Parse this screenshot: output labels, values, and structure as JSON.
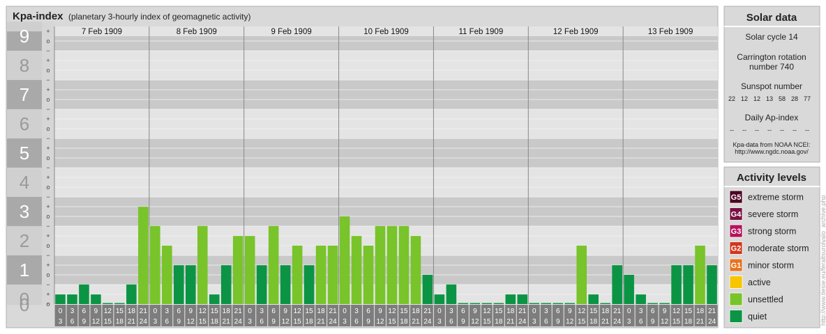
{
  "header": {
    "title": "Kpa-index",
    "subtitle": "(planetary 3-hourly index of geomagnetic activity)"
  },
  "chart_data": {
    "type": "bar",
    "days": [
      "7 Feb 1909",
      "8 Feb 1909",
      "9 Feb 1909",
      "10 Feb 1909",
      "11 Feb 1909",
      "12 Feb 1909",
      "13 Feb 1909"
    ],
    "hour_start_labels": [
      "0",
      "3",
      "6",
      "9",
      "12",
      "15",
      "18",
      "21"
    ],
    "hour_end_labels": [
      "3",
      "6",
      "9",
      "12",
      "15",
      "18",
      "21",
      "24"
    ],
    "y_tick_labels": [
      "0",
      "1",
      "2",
      "3",
      "4",
      "5",
      "6",
      "7",
      "8",
      "9"
    ],
    "y_sub_labels": [
      "o",
      "+",
      "−"
    ],
    "ylim": [
      0,
      9.33
    ],
    "values": [
      0.33,
      0.33,
      0.67,
      0.33,
      0,
      0,
      0.67,
      3.33,
      2.67,
      2,
      1.33,
      1.33,
      2.67,
      0.33,
      1.33,
      2.33,
      2.33,
      1.33,
      2.67,
      1.33,
      2,
      1.33,
      2,
      2,
      3,
      2.33,
      2,
      2.67,
      2.67,
      2.67,
      2.33,
      1,
      0.33,
      0.67,
      0,
      0,
      0,
      0,
      0.33,
      0.33,
      0,
      0,
      0,
      0,
      2,
      0.33,
      0,
      1.33,
      1,
      0.33,
      0,
      0,
      1.33,
      1.33,
      2,
      1.33
    ],
    "colors": {
      "quiet": "#0b9444",
      "unsettled": "#78c42a",
      "active": "#f7c600",
      "minor": "#e8731f",
      "moderate": "#d2371d",
      "strong": "#b5125b",
      "severe": "#7a1044",
      "extreme": "#4d0425"
    },
    "grid": true
  },
  "solar": {
    "title": "Solar data",
    "cycle": "Solar cycle 14",
    "carrington_line1": "Carrington rotation",
    "carrington_line2": "number 740",
    "sunspot_label": "Sunspot number",
    "sunspot_values": [
      "22",
      "12",
      "12",
      "13",
      "58",
      "28",
      "77"
    ],
    "ap_label": "Daily Ap-index",
    "ap_values": [
      "--",
      "--",
      "--",
      "--",
      "--",
      "--",
      "--"
    ],
    "source_line1": "Kpa-data from NOAA NCEI:",
    "source_line2": "http://www.ngdc.noaa.gov/"
  },
  "activity": {
    "title": "Activity levels",
    "levels": [
      {
        "badge": "G5",
        "label": "extreme storm",
        "color": "#4d0425"
      },
      {
        "badge": "G4",
        "label": "severe storm",
        "color": "#7a1044"
      },
      {
        "badge": "G3",
        "label": "strong storm",
        "color": "#b5125b"
      },
      {
        "badge": "G2",
        "label": "moderate storm",
        "color": "#d2371d"
      },
      {
        "badge": "G1",
        "label": "minor storm",
        "color": "#e8731f"
      },
      {
        "badge": "",
        "label": "active",
        "color": "#f7c600"
      },
      {
        "badge": "",
        "label": "unsettled",
        "color": "#78c42a"
      },
      {
        "badge": "",
        "label": "quiet",
        "color": "#0b9444"
      }
    ]
  },
  "credit": "http://www.tiesie.eu/feraltsurolyalo_archive.php"
}
